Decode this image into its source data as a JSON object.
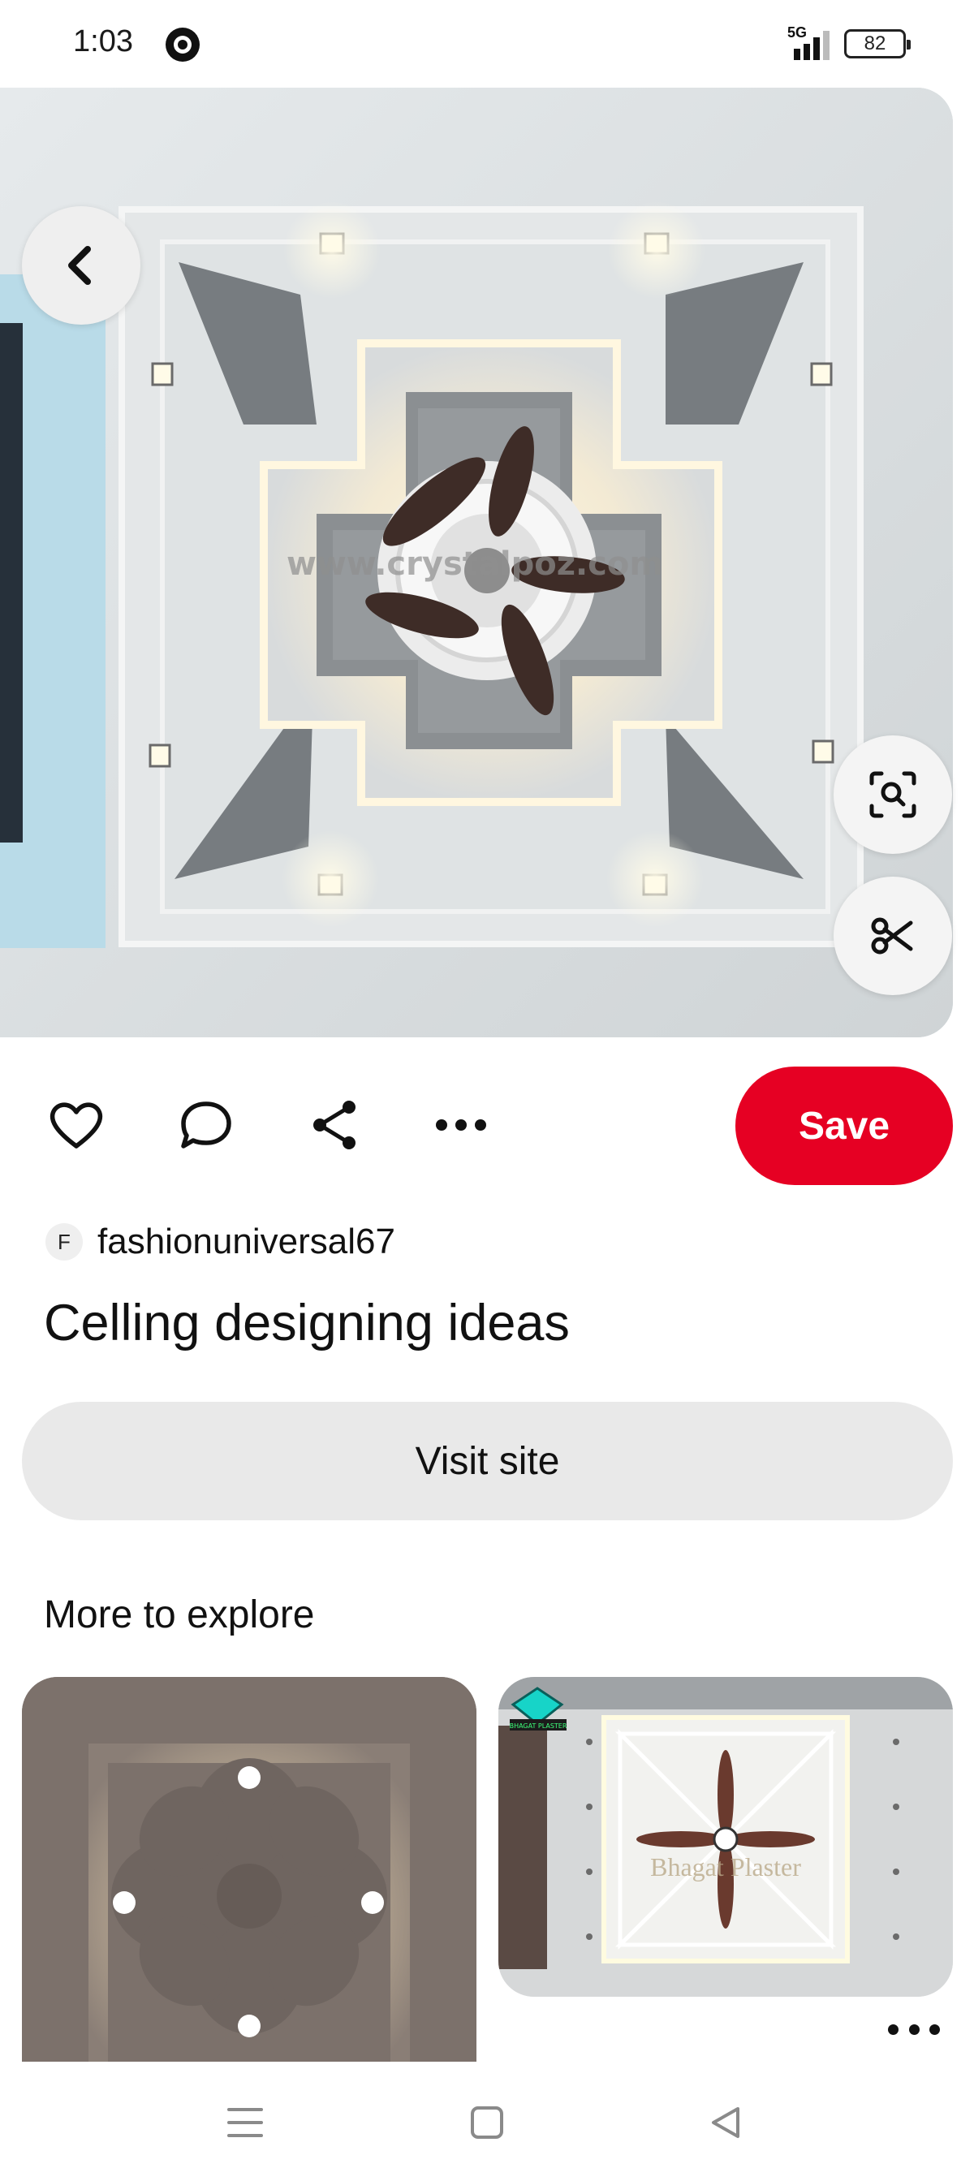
{
  "status_bar": {
    "time": "1:03",
    "network": "5G",
    "signal_level": 0.75,
    "battery": "82"
  },
  "hero": {
    "watermark": "www.crystalpoz.com",
    "back_icon": "chevron-left-icon",
    "visual_search_icon": "visual-search-icon",
    "cutout_icon": "scissors-icon"
  },
  "actions": {
    "like_icon": "heart-icon",
    "comment_icon": "comment-icon",
    "share_icon": "share-icon",
    "more_icon": "more-icon",
    "save_label": "Save"
  },
  "creator": {
    "initial": "F",
    "name": "fashionuniversal67"
  },
  "pin": {
    "title": "Celling designing ideas",
    "visit_label": "Visit site"
  },
  "explore": {
    "title": "More to explore",
    "cards": [
      {
        "image": "flower-ceiling-design"
      },
      {
        "image": "fan-ceiling-design",
        "watermark": "Bhagat Plaster",
        "badge": "BHAGAT PLASTER"
      }
    ]
  },
  "nav": {
    "menu_icon": "menu-icon",
    "home_icon": "home-square-icon",
    "back_icon": "back-triangle-icon"
  },
  "colors": {
    "save": "#e60023",
    "visit_bg": "#e9e9e9"
  }
}
